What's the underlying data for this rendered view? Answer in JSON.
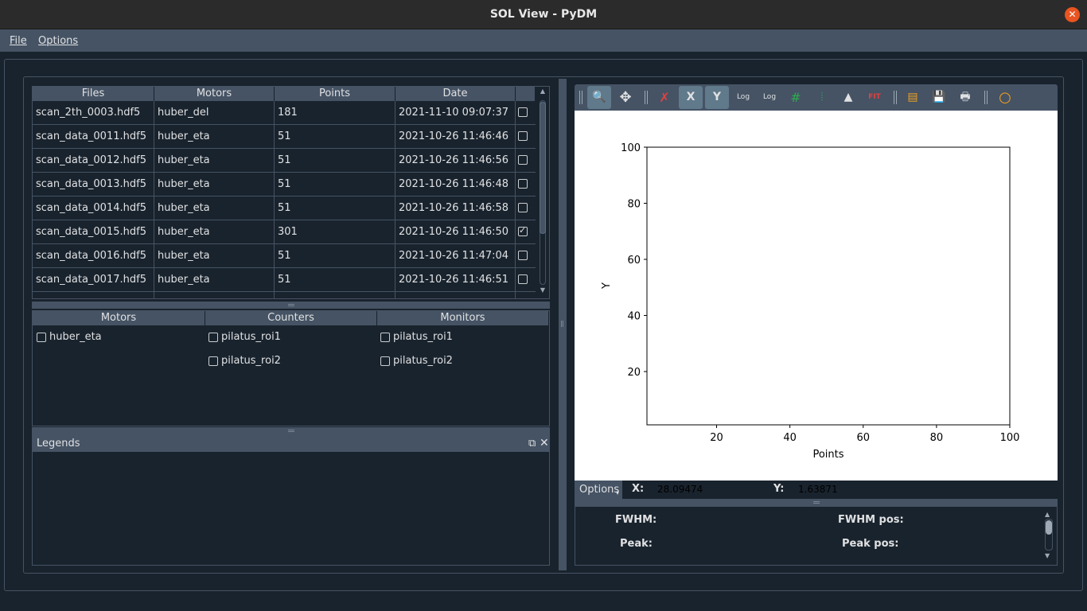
{
  "window": {
    "title": "SOL View - PyDM",
    "close_glyph": "✕"
  },
  "menu": {
    "file": "File",
    "options": "Options"
  },
  "files_table": {
    "headers": [
      "Files",
      "Motors",
      "Points",
      "Date"
    ],
    "rows": [
      {
        "file": "scan_2th_0003.hdf5",
        "motor": "huber_del",
        "points": "181",
        "date": "2021-11-10 09:07:37",
        "checked": false
      },
      {
        "file": "scan_data_0011.hdf5",
        "motor": "huber_eta",
        "points": "51",
        "date": "2021-10-26 11:46:46",
        "checked": false
      },
      {
        "file": "scan_data_0012.hdf5",
        "motor": "huber_eta",
        "points": "51",
        "date": "2021-10-26 11:46:56",
        "checked": false
      },
      {
        "file": "scan_data_0013.hdf5",
        "motor": "huber_eta",
        "points": "51",
        "date": "2021-10-26 11:46:48",
        "checked": false
      },
      {
        "file": "scan_data_0014.hdf5",
        "motor": "huber_eta",
        "points": "51",
        "date": "2021-10-26 11:46:58",
        "checked": false
      },
      {
        "file": "scan_data_0015.hdf5",
        "motor": "huber_eta",
        "points": "301",
        "date": "2021-10-26 11:46:50",
        "checked": true
      },
      {
        "file": "scan_data_0016.hdf5",
        "motor": "huber_eta",
        "points": "51",
        "date": "2021-10-26 11:47:04",
        "checked": false
      },
      {
        "file": "scan_data_0017.hdf5",
        "motor": "huber_eta",
        "points": "51",
        "date": "2021-10-26 11:46:51",
        "checked": false
      }
    ]
  },
  "signals": {
    "headers": [
      "Motors",
      "Counters",
      "Monitors"
    ],
    "motors": [
      "huber_eta"
    ],
    "counters": [
      "pilatus_roi1",
      "pilatus_roi2"
    ],
    "monitors": [
      "pilatus_roi1",
      "pilatus_roi2"
    ]
  },
  "legends": {
    "title": "Legends",
    "float_glyph": "⧉",
    "close_glyph": "✕"
  },
  "toolbar": {
    "icons": [
      "zoom-icon",
      "pan-icon",
      "reset-zoom-icon",
      "x-autoscale-icon",
      "y-autoscale-icon",
      "x-log-icon",
      "y-log-icon",
      "grid-icon",
      "curve-style-icon",
      "gaussian-icon",
      "fit-icon",
      "copy-icon",
      "save-icon",
      "print-icon",
      "roi-icon"
    ],
    "x_label": "X",
    "y_label": "Y",
    "log_label": "Log",
    "fit_label": "FIT"
  },
  "chart_data": {
    "type": "line",
    "title": "",
    "xlabel": "Points",
    "ylabel": "Y",
    "xlim": [
      1,
      100
    ],
    "ylim": [
      1,
      100
    ],
    "xticks": [
      20,
      40,
      60,
      80,
      100
    ],
    "yticks": [
      20,
      40,
      60,
      80,
      100
    ],
    "series": [],
    "grid": false
  },
  "status": {
    "options_label": "Options",
    "x_label": "X:",
    "x_value": "28.09474",
    "y_label": "Y:",
    "y_value": "1.63871"
  },
  "fit": {
    "fwhm_label": "FWHM:",
    "fwhm_pos_label": "FWHM pos:",
    "peak_label": "Peak:",
    "peak_pos_label": "Peak pos:"
  },
  "colors": {
    "background": "#19232d",
    "panel": "#455364",
    "accent_close": "#e95420",
    "toolbar_active": "#60798b"
  }
}
